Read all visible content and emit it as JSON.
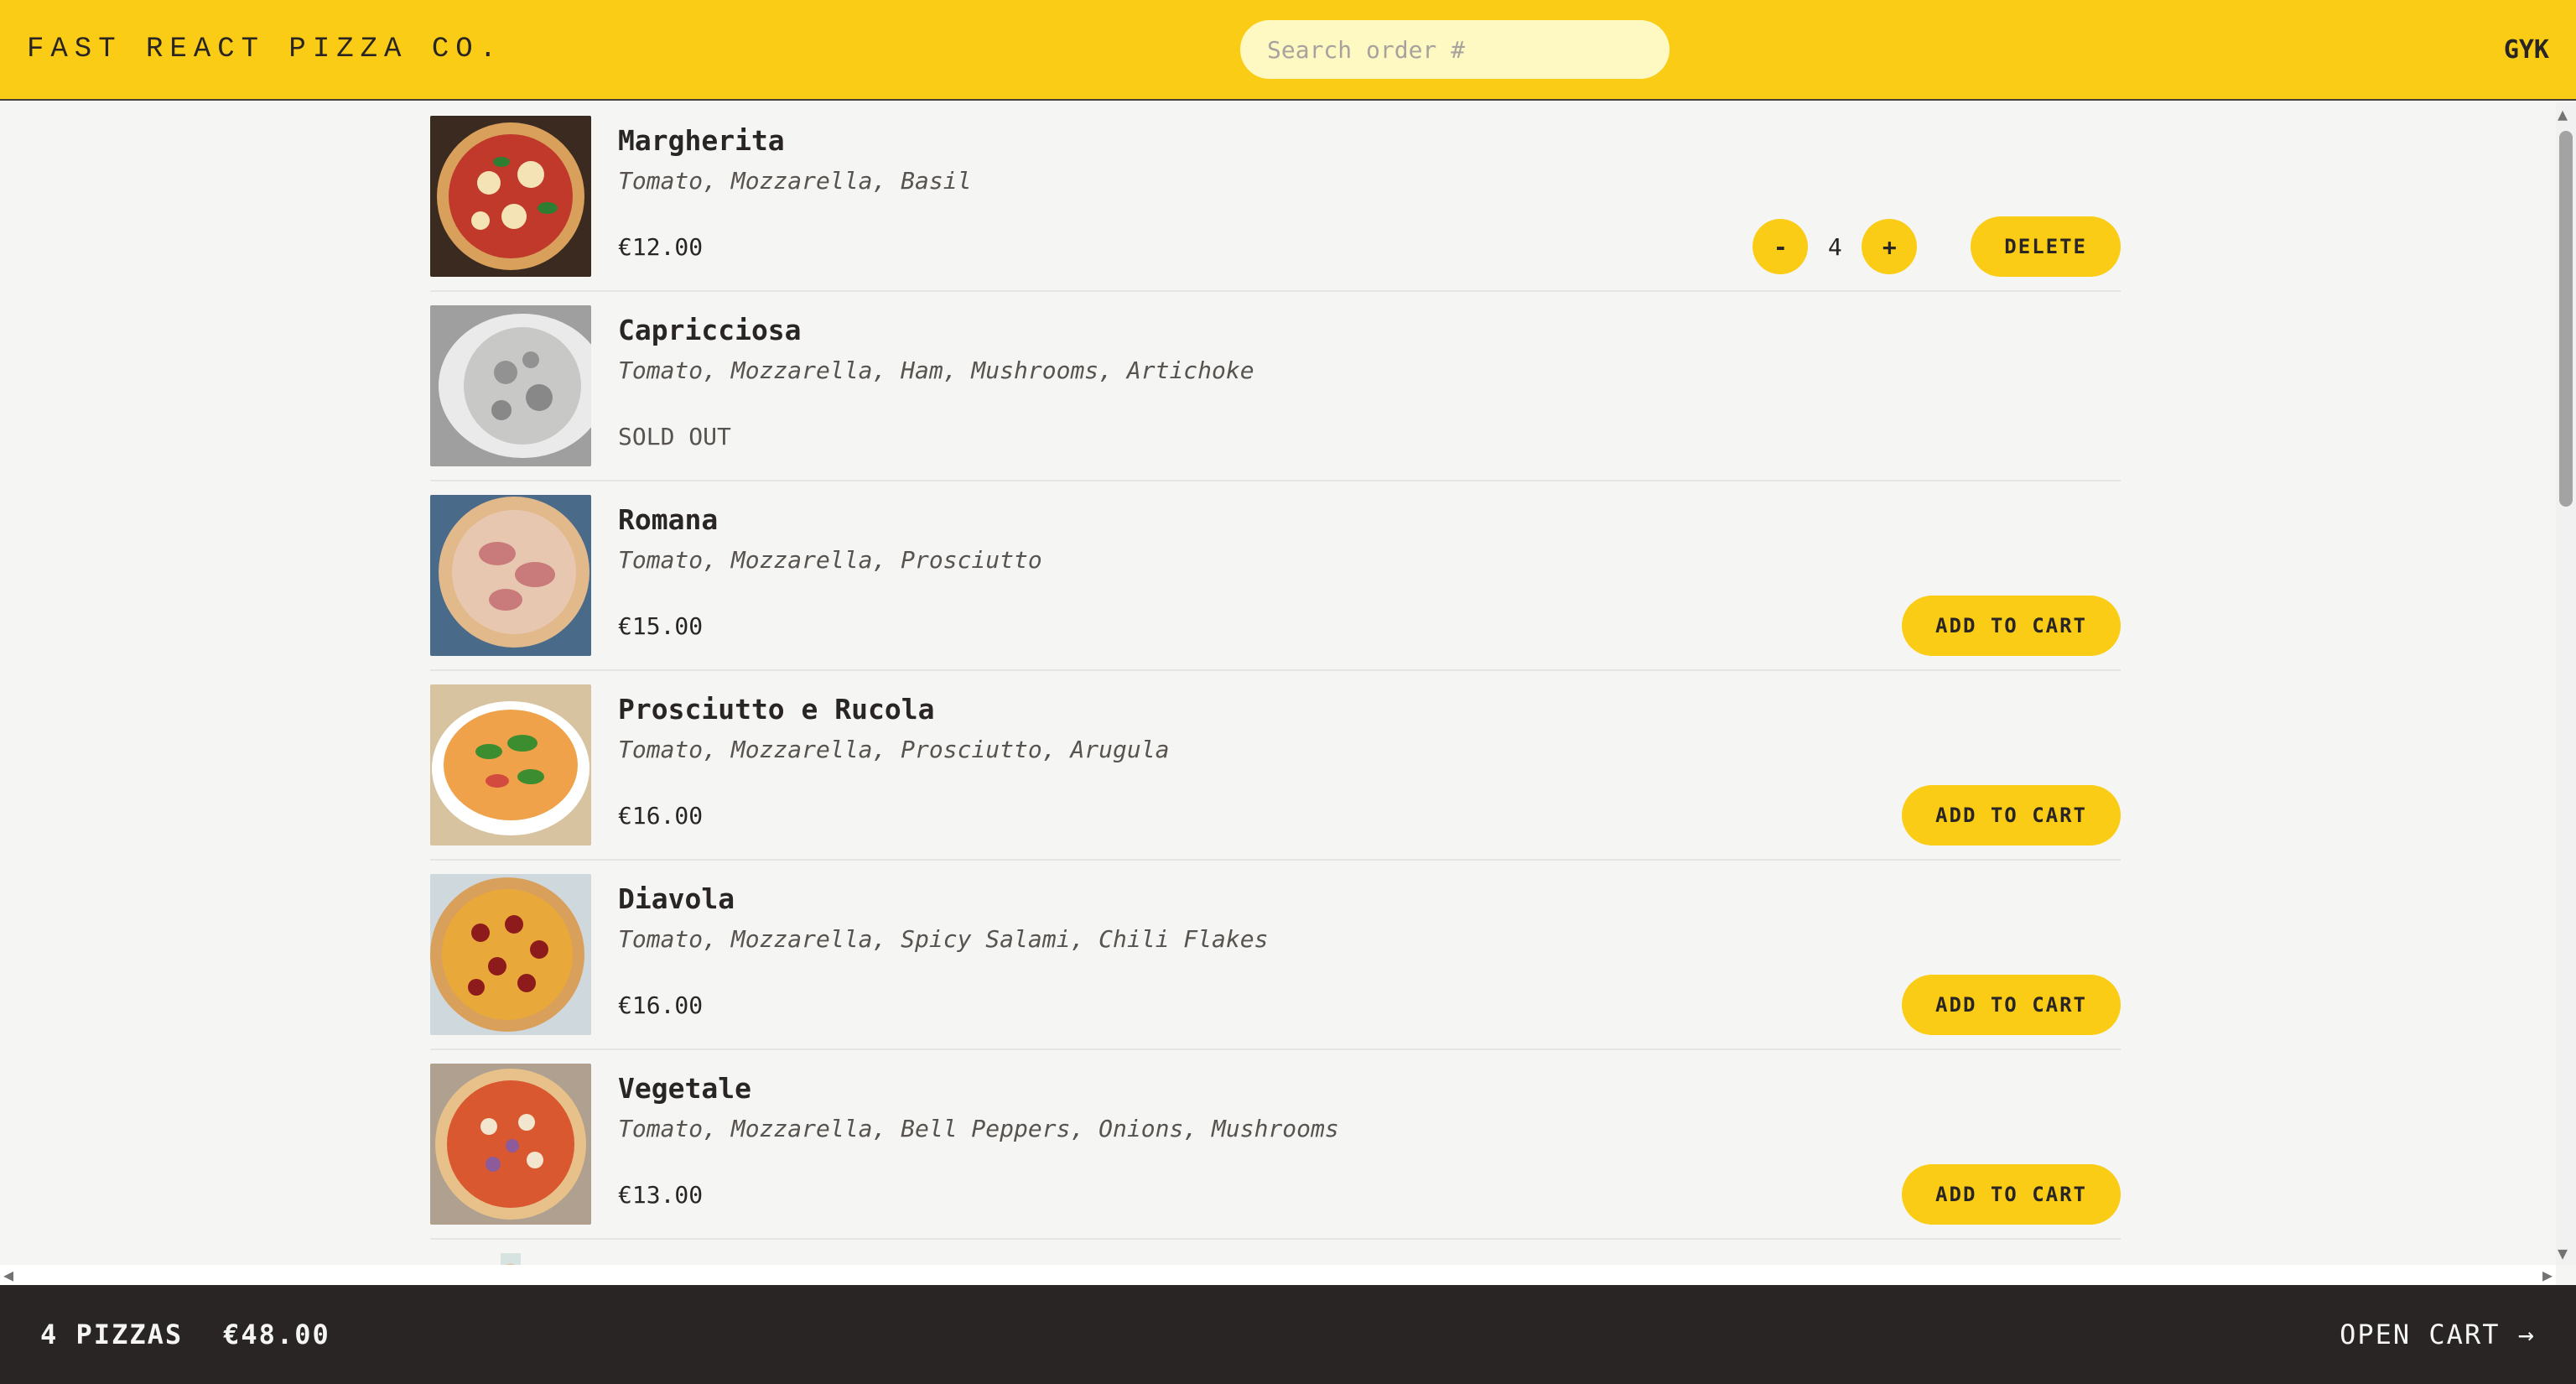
{
  "header": {
    "logo": "Fast React Pizza Co.",
    "search_placeholder": "Search order #",
    "username": "GYK"
  },
  "menu": [
    {
      "name": "Margherita",
      "ingredients": "Tomato, Mozzarella, Basil",
      "price": "€12.00",
      "sold_out": false,
      "in_cart": true,
      "quantity": "4"
    },
    {
      "name": "Capricciosa",
      "ingredients": "Tomato, Mozzarella, Ham, Mushrooms, Artichoke",
      "price": "",
      "sold_out": true,
      "status": "SOLD OUT"
    },
    {
      "name": "Romana",
      "ingredients": "Tomato, Mozzarella, Prosciutto",
      "price": "€15.00",
      "sold_out": false
    },
    {
      "name": "Prosciutto e Rucola",
      "ingredients": "Tomato, Mozzarella, Prosciutto, Arugula",
      "price": "€16.00",
      "sold_out": false
    },
    {
      "name": "Diavola",
      "ingredients": "Tomato, Mozzarella, Spicy Salami, Chili Flakes",
      "price": "€16.00",
      "sold_out": false
    },
    {
      "name": "Vegetale",
      "ingredients": "Tomato, Mozzarella, Bell Peppers, Onions, Mushrooms",
      "price": "€13.00",
      "sold_out": false
    }
  ],
  "buttons": {
    "add_to_cart": "Add to cart",
    "delete": "Delete",
    "decrease": "-",
    "increase": "+"
  },
  "cart_overview": {
    "pizzas": "4 PIZZAS",
    "total": "€48.00",
    "open_cart": "Open cart →"
  },
  "colors": {
    "accent": "#facc15",
    "footer_bg": "#292524",
    "page_bg": "#f5f5f4"
  }
}
